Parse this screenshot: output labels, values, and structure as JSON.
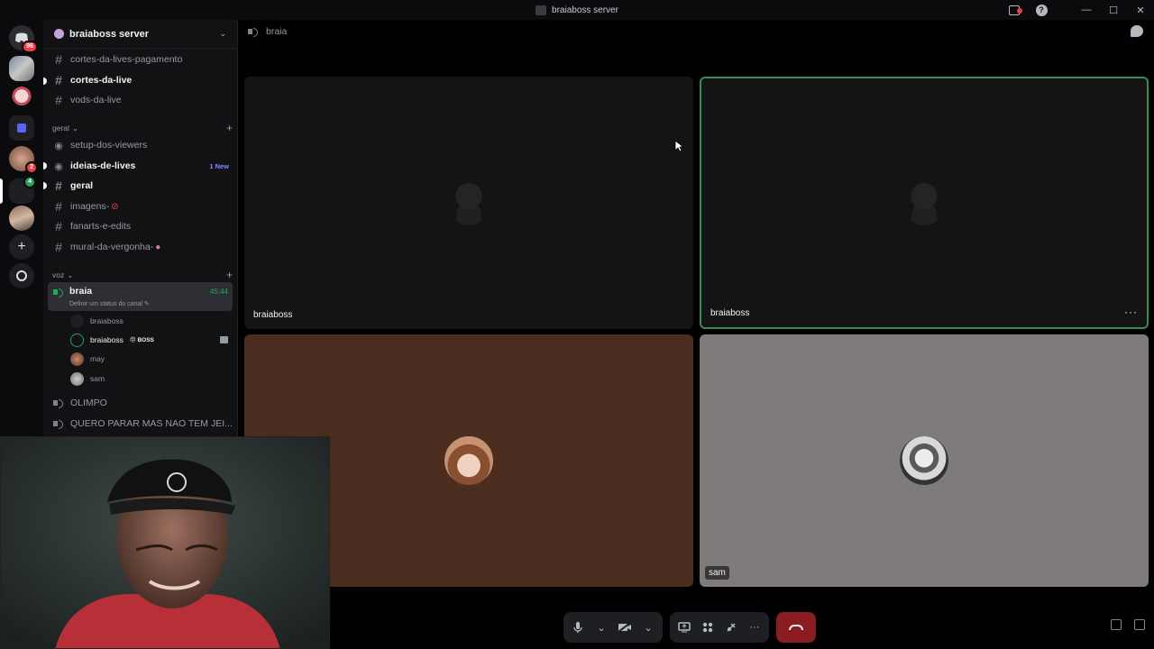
{
  "window": {
    "title": "braiaboss server",
    "controls": [
      "—",
      "☐",
      "✕"
    ],
    "help": "?"
  },
  "rail": {
    "home_badge": "96",
    "server_badge_2": "2",
    "server_badge_3": "4"
  },
  "sidebar": {
    "server_name": "braiaboss server",
    "channels_top": [
      {
        "name": "cortes-da-lives-pagamento"
      },
      {
        "name": "cortes-da-live"
      },
      {
        "name": "vods-da-live"
      }
    ],
    "category_geral": "geral",
    "channels_geral": [
      {
        "name": "setup-dos-viewers"
      },
      {
        "name": "ideias-de-lives",
        "tag": "1 New"
      },
      {
        "name": "geral"
      },
      {
        "name": "imagens-"
      },
      {
        "name": "fanarts-e-edits"
      },
      {
        "name": "mural-da-vergonha-"
      }
    ],
    "category_voz": "voz",
    "voice_active": {
      "name": "braia",
      "status": "Definir um status do canal ✎",
      "time": "45:44"
    },
    "voice_users": [
      {
        "name": "braiaboss"
      },
      {
        "name": "braiaboss",
        "tag": "😠 BOSS"
      },
      {
        "name": "may"
      },
      {
        "name": "sam"
      }
    ],
    "voice_channels": [
      {
        "name": "OLIMPO"
      },
      {
        "name": "QUERO PARAR MAS NAO TEM JEI..."
      }
    ]
  },
  "main": {
    "channel": "braia",
    "tiles": [
      {
        "label": "braiaboss"
      },
      {
        "label": "braiaboss",
        "more": "···"
      },
      {
        "label": ""
      },
      {
        "label": "sam"
      }
    ]
  },
  "colors": {
    "accent_green": "#23a55a",
    "danger": "#f23f43",
    "tile_dark": "#141414",
    "tile_brown": "#4b2d1f",
    "tile_gray": "#7f7b7a"
  }
}
